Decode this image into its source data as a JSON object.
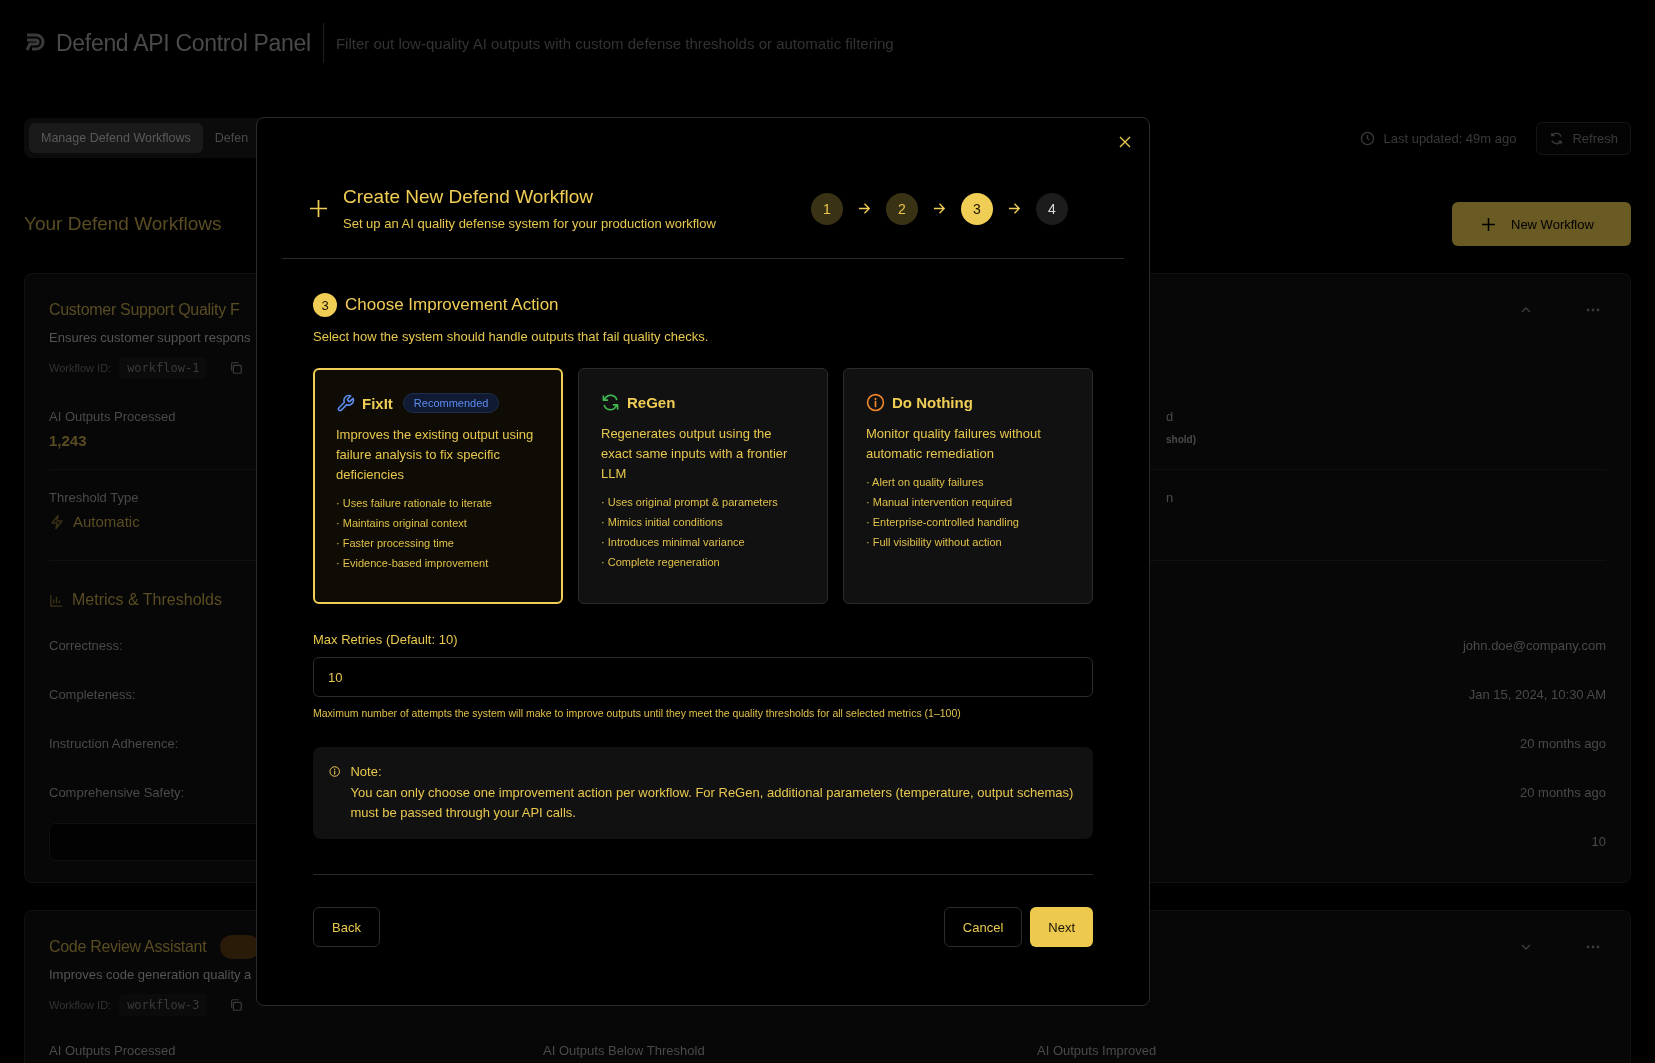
{
  "header": {
    "title": "Defend API Control Panel",
    "subtitle": "Filter out low-quality AI outputs with custom defense thresholds or automatic filtering"
  },
  "tabs": [
    {
      "label": "Manage Defend Workflows",
      "selected": true
    },
    {
      "label": "Defen",
      "selected": false
    }
  ],
  "last_updated": "Last updated: 49m ago",
  "refresh_button": "Refresh",
  "section_title": "Your Defend Workflows",
  "new_workflow_button": "New Workflow",
  "workflows": [
    {
      "title": "Customer Support Quality F",
      "description": "Ensures customer support respons",
      "id_label": "Workflow ID:",
      "id": "workflow-1",
      "expanded": true,
      "stat_label": "AI Outputs Processed",
      "stat_value": "1,243",
      "stat_fragments": [
        "d",
        "shold)"
      ],
      "threshold_label": "Threshold Type",
      "threshold_value": "Automatic",
      "threshold_fragment": "n",
      "metrics_title": "Metrics & Thresholds",
      "metrics": [
        "Correctness:",
        "Completeness:",
        "Instruction Adherence:",
        "Comprehensive Safety:"
      ],
      "details": [
        "john.doe@company.com",
        "Jan 15, 2024, 10:30 AM",
        "20 months ago",
        "20 months ago",
        "10"
      ]
    },
    {
      "title": "Code Review Assistant",
      "description": "Improves code generation quality a",
      "id_label": "Workflow ID:",
      "id": "workflow-3",
      "expanded": false,
      "stat_labels": [
        "AI Outputs Processed",
        "AI Outputs Below Threshold",
        "AI Outputs Improved"
      ]
    }
  ],
  "dialog": {
    "title": "Create New Defend Workflow",
    "subtitle": "Set up an AI quality defense system for your production workflow",
    "steps": [
      {
        "label": "1",
        "completed": true,
        "selected": false
      },
      {
        "label": "2",
        "completed": true,
        "selected": false
      },
      {
        "label": "3",
        "completed": false,
        "selected": true
      },
      {
        "label": "4",
        "completed": false,
        "selected": false
      }
    ],
    "step_number": "3",
    "step_title": "Choose Improvement Action",
    "step_description": "Select how the system should handle outputs that fail quality checks.",
    "actions": [
      {
        "kind": "fix",
        "name": "FixIt",
        "badge": "Recommended",
        "selected": true,
        "color": "#5b8def",
        "description": "Improves the existing output using failure analysis to fix specific deficiencies",
        "bullets": [
          "· Uses failure rationale to iterate",
          "· Maintains original context",
          "· Faster processing time",
          "· Evidence-based improvement"
        ]
      },
      {
        "kind": "regen",
        "name": "ReGen",
        "selected": false,
        "color": "#3fb950",
        "description": "Regenerates output using the exact same inputs with a frontier LLM",
        "bullets": [
          "· Uses original prompt & parameters",
          "· Mimics initial conditions",
          "· Introduces minimal variance",
          "· Complete regeneration"
        ]
      },
      {
        "kind": "monitor",
        "name": "Do Nothing",
        "selected": false,
        "color": "#f0862a",
        "description": "Monitor quality failures without automatic remediation",
        "bullets": [
          "· Alert on quality failures",
          "· Manual intervention required",
          "· Enterprise-controlled handling",
          "· Full visibility without action"
        ]
      }
    ],
    "max_retries": {
      "label": "Max Retries (Default: 10)",
      "value": "10",
      "help": "Maximum number of attempts the system will make to improve outputs until they meet the quality thresholds for all selected metrics (1–100)"
    },
    "note": {
      "title": "Note:",
      "text": "You can only choose one improvement action per workflow. For ReGen, additional parameters (temperature, output schemas) must be passed through your API calls."
    },
    "buttons": {
      "back": "Back",
      "cancel": "Cancel",
      "next": "Next"
    }
  }
}
